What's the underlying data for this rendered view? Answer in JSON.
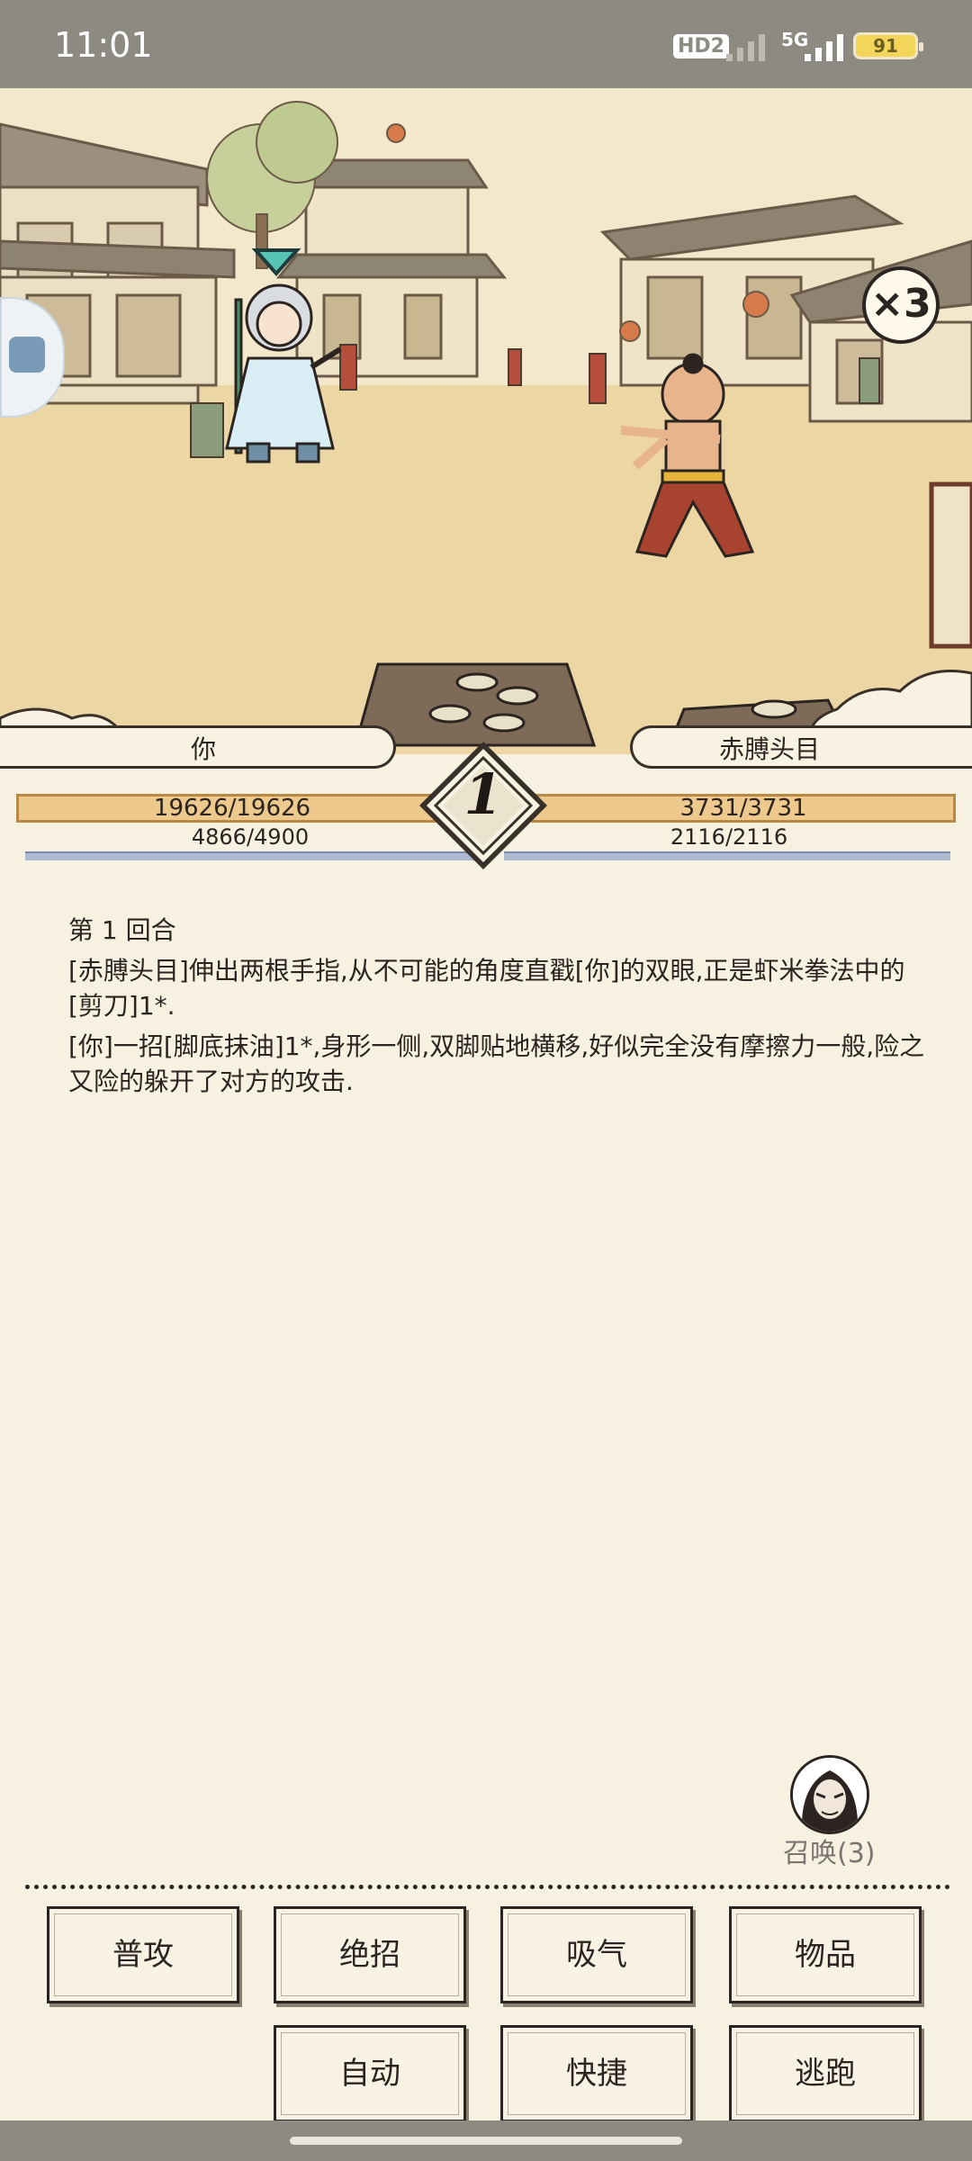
{
  "status_bar": {
    "time": "11:01",
    "hd_badge": "HD2",
    "network": "5G",
    "battery": "91"
  },
  "scene": {
    "speed_multiplier": "×3"
  },
  "player": {
    "name": "你",
    "hp": "19626/19626",
    "mp": "4866/4900",
    "hp_fraction": 1.0,
    "mp_fraction": 0.993
  },
  "enemy": {
    "name": "赤膊头目",
    "hp": "3731/3731",
    "mp": "2116/2116",
    "hp_fraction": 1.0,
    "mp_fraction": 1.0
  },
  "round_number": "1",
  "battle_log": [
    "第 1 回合",
    "[赤膊头目]伸出两根手指,从不可能的角度直戳[你]的双眼,正是虾米拳法中的[剪刀]1*.",
    "[你]一招[脚底抹油]1*,身形一侧,双脚贴地横移,好似完全没有摩擦力一般,险之又险的躲开了对方的攻击."
  ],
  "summon": {
    "label": "召唤(3)"
  },
  "actions": {
    "attack": "普攻",
    "ultimate": "绝招",
    "breathe": "吸气",
    "items": "物品",
    "auto": "自动",
    "shortcut": "快捷",
    "flee": "逃跑"
  },
  "colors": {
    "hp_fill": "#eec98e",
    "mp_fill": "#aeb8d0",
    "panel_bg": "#f7f1e1"
  }
}
